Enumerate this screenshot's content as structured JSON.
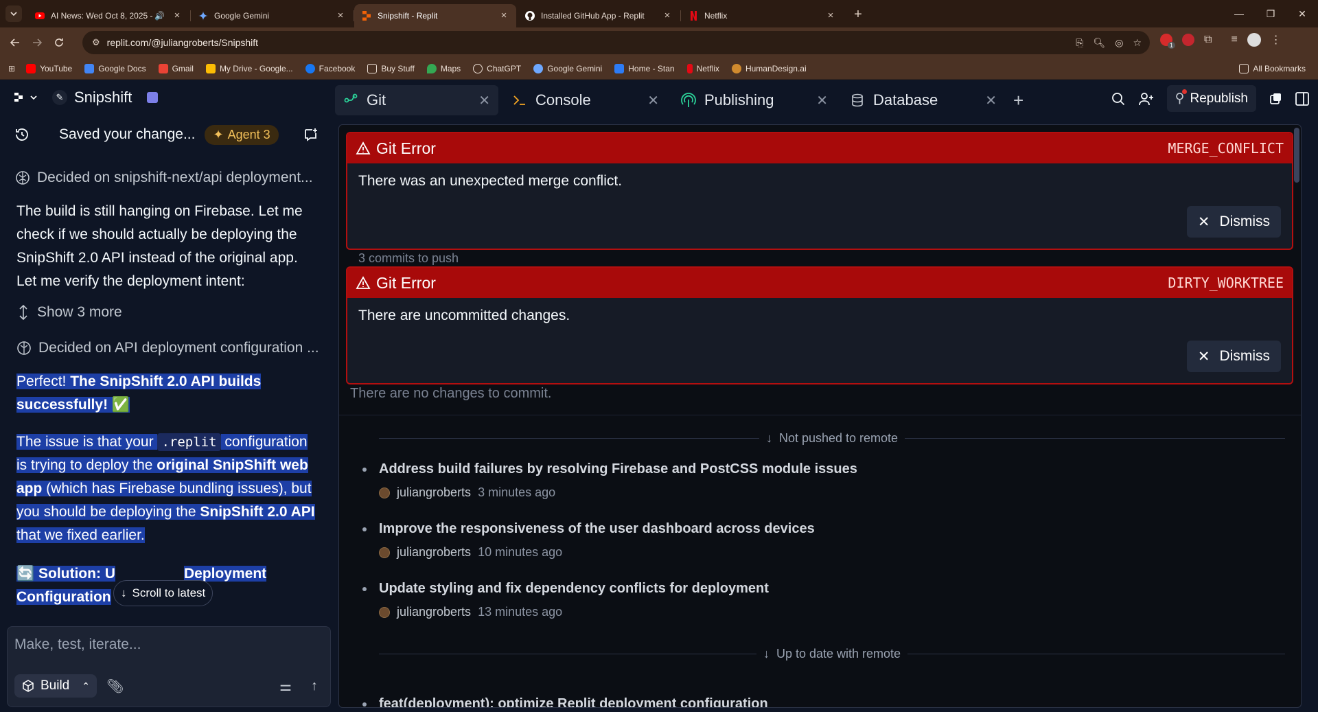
{
  "browser": {
    "tabs": [
      {
        "title": "AI News: Wed Oct 8, 2025 -",
        "active": false,
        "favicon": "youtube-icon",
        "audio": true
      },
      {
        "title": "Google Gemini",
        "active": false,
        "favicon": "gemini-icon"
      },
      {
        "title": "Snipshift - Replit",
        "active": true,
        "favicon": "replit-icon"
      },
      {
        "title": "Installed GitHub App - Replit",
        "active": false,
        "favicon": "github-icon"
      },
      {
        "title": "Netflix",
        "active": false,
        "favicon": "netflix-icon"
      }
    ],
    "url": "replit.com/@juliangroberts/Snipshift",
    "bookmarks": [
      "YouTube",
      "Google Docs",
      "Gmail",
      "My Drive - Google...",
      "Facebook",
      "Buy Stuff",
      "Maps",
      "ChatGPT",
      "Google Gemini",
      "Home - Stan",
      "Netflix",
      "HumanDesign.ai"
    ],
    "all_bookmarks": "All Bookmarks",
    "ext_badge": "1"
  },
  "left": {
    "project": "Snipshift",
    "checkpoint": "Saved your change...",
    "agent": "Agent 3",
    "decided1": "Decided on snipshift-next/api deployment...",
    "para1": "The build is still hanging on Firebase. Let me check if we should actually be deploying the SnipShift 2.0 API instead of the original app. Let me verify the deployment intent:",
    "show_more": "Show 3 more",
    "decided2": "Decided on API deployment configuration ...",
    "p2a": "Perfect! ",
    "p2b": "The SnipShift 2.0 API builds successfully!",
    "p2c": " ✅",
    "p3a": "The issue is that your ",
    "p3code": ".replit",
    "p3b": " configuration is trying to deploy the ",
    "p3c": "original SnipShift web app",
    "p3d": " (which has Firebase bundling issues), but you should be deploying the ",
    "p3e": "SnipShift 2.0 API",
    "p3f": " that we fixed earlier.",
    "p4a": "🔄 Solution: U",
    "p4b": "Deployment Configuration",
    "scroll_latest": "Scroll to latest",
    "placeholder": "Make, test, iterate...",
    "build": "Build"
  },
  "right": {
    "tabs": [
      {
        "label": "Git",
        "icon": "git-icon",
        "active": true
      },
      {
        "label": "Console",
        "icon": "console-icon",
        "active": false
      },
      {
        "label": "Publishing",
        "icon": "publishing-icon",
        "active": false
      },
      {
        "label": "Database",
        "icon": "database-icon",
        "active": false
      }
    ],
    "republish": "Republish",
    "errors": [
      {
        "title": "Git Error",
        "code": "MERGE_CONFLICT",
        "message": "There was an unexpected merge conflict.",
        "dismiss": "Dismiss"
      },
      {
        "title": "Git Error",
        "code": "DIRTY_WORKTREE",
        "message": "There are uncommitted changes.",
        "dismiss": "Dismiss"
      }
    ],
    "commits_to_push": "3 commits to push",
    "no_changes": "There are no changes to commit.",
    "not_pushed": "Not pushed to remote",
    "commits": [
      {
        "title": "Address build failures by resolving Firebase and PostCSS module issues",
        "author": "juliangroberts",
        "time": "3 minutes ago"
      },
      {
        "title": "Improve the responsiveness of the user dashboard across devices",
        "author": "juliangroberts",
        "time": "10 minutes ago"
      },
      {
        "title": "Update styling and fix dependency conflicts for deployment",
        "author": "juliangroberts",
        "time": "13 minutes ago"
      }
    ],
    "up_to_date": "Up to date with remote",
    "next_commit": "feat(deployment): optimize Replit deployment configuration"
  },
  "colors": {
    "error_red": "#a80a0a",
    "accent_blue": "#1d3fa6",
    "agent_gold": "#f3c15a"
  }
}
